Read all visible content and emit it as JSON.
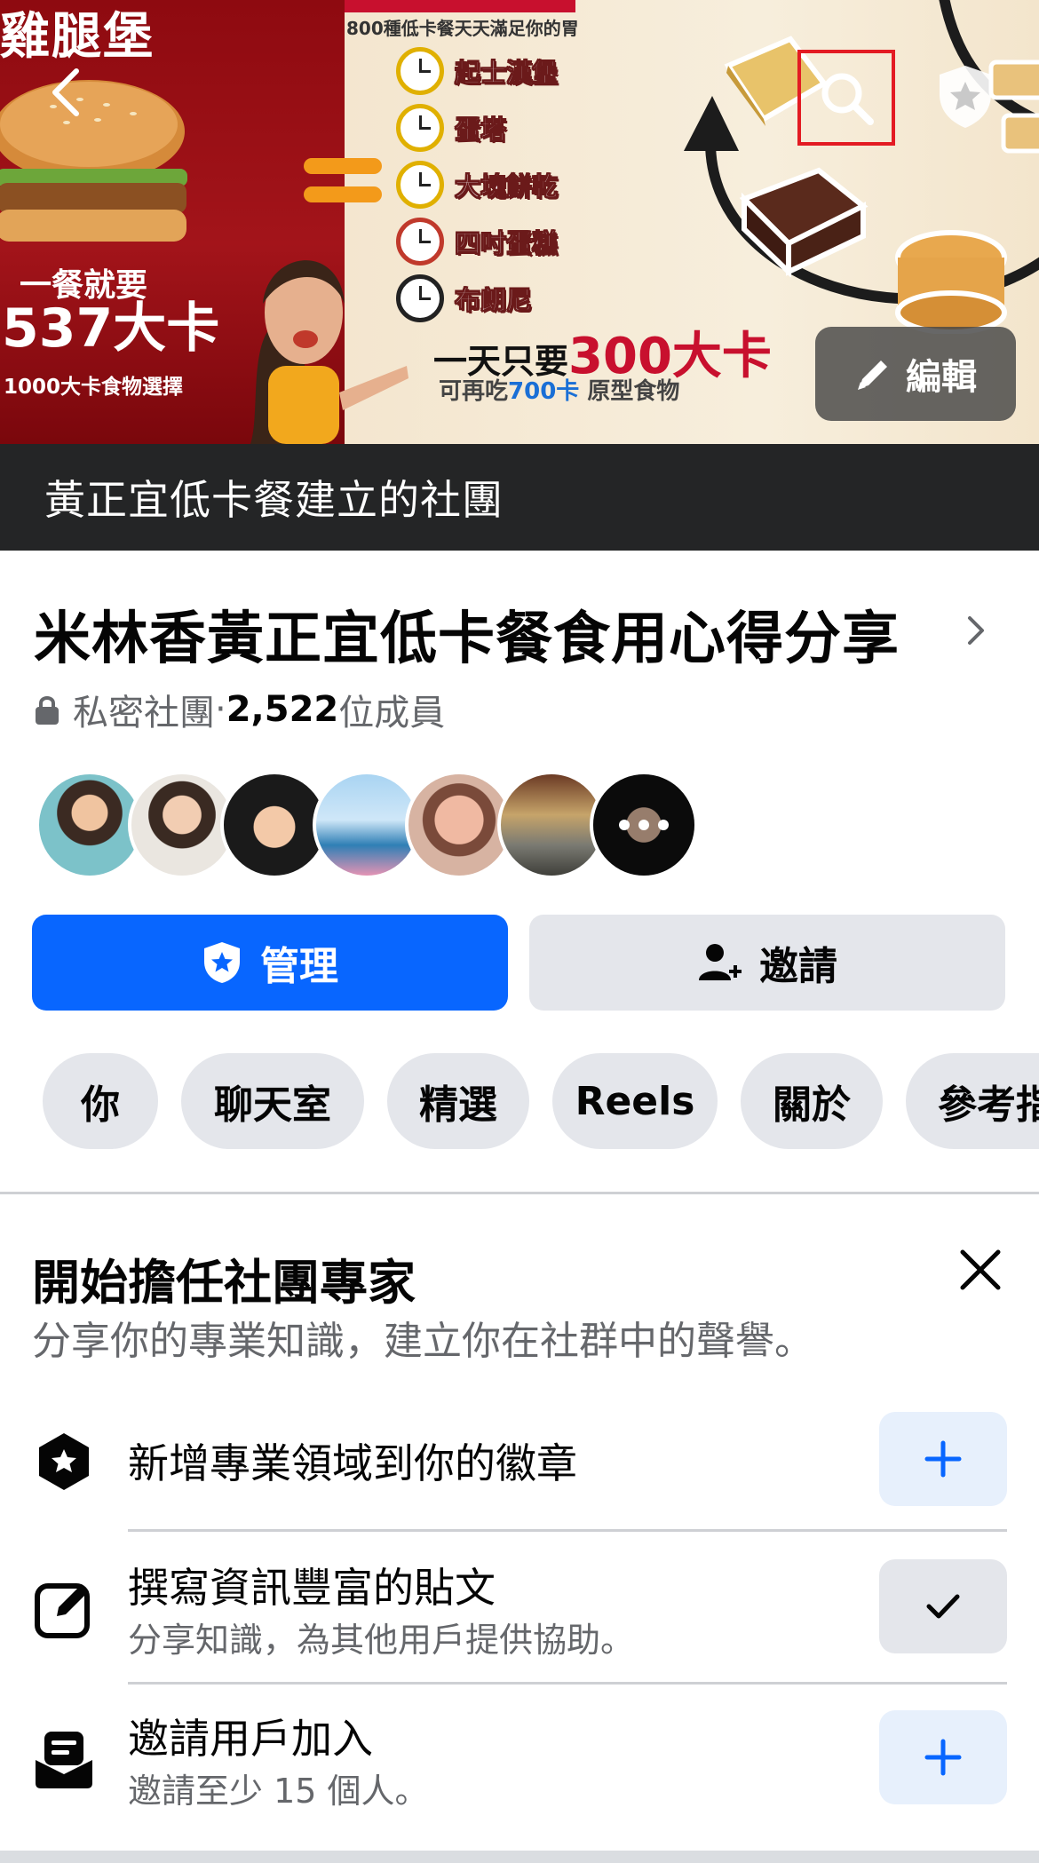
{
  "cover": {
    "ad_title": "雞腿堡",
    "ad_meal": "一餐就要",
    "ad_kcal": "537大卡",
    "ad_choice": "1000大卡食物選擇",
    "ad_sub": "800種低卡餐天天滿足你的胃",
    "clock_items": [
      "起士漢堡",
      "蛋塔",
      "大塊餅乾",
      "四吋蛋糕",
      "布朗尼"
    ],
    "ad_day_prefix": "一天只要",
    "ad_day_kcal": "300大卡",
    "ad_more_prefix": "可再吃",
    "ad_more_kcal": "700卡",
    "ad_more_suffix": " 原型食物",
    "edit_label": "編輯"
  },
  "creator_bar": "黃正宜低卡餐建立的社團",
  "group": {
    "title": "米林香黃正宜低卡餐食用心得分享",
    "privacy": "私密社團",
    "separator": " · ",
    "member_count": "2,522",
    "member_suffix": " 位成員"
  },
  "actions": {
    "manage_label": "管理",
    "invite_label": "邀請"
  },
  "tabs": [
    "你",
    "聊天室",
    "精選",
    "Reels",
    "關於",
    "參考指南"
  ],
  "expert_card": {
    "title": "開始擔任社團專家",
    "subtitle": "分享你的專業知識，建立你在社群中的聲譽。",
    "tasks": [
      {
        "title": "新增專業領域到你的徽章",
        "desc": "",
        "state": "add"
      },
      {
        "title": "撰寫資訊豐富的貼文",
        "desc": "分享知識，為其他用戶提供協助。",
        "state": "done"
      },
      {
        "title": "邀請用戶加入",
        "desc": "邀請至少 15 個人。",
        "state": "add"
      }
    ]
  },
  "colors": {
    "primary": "#0866ff",
    "secondary_button": "#e4e6eb",
    "add_button_bg": "#e7f0fc",
    "text_primary": "#050505",
    "text_secondary": "#65676b",
    "highlight_box": "#e31b23"
  },
  "icons": {
    "back": "chevron-left-icon",
    "search": "search-icon",
    "shield": "shield-star-icon",
    "edit": "pencil-icon",
    "lock": "lock-icon",
    "manage": "shield-star-icon",
    "invite": "person-add-icon",
    "close": "close-icon",
    "badge": "star-badge-icon",
    "write": "edit-square-icon",
    "invite_users": "inbox-icon",
    "plus": "plus-icon",
    "check": "check-icon"
  }
}
